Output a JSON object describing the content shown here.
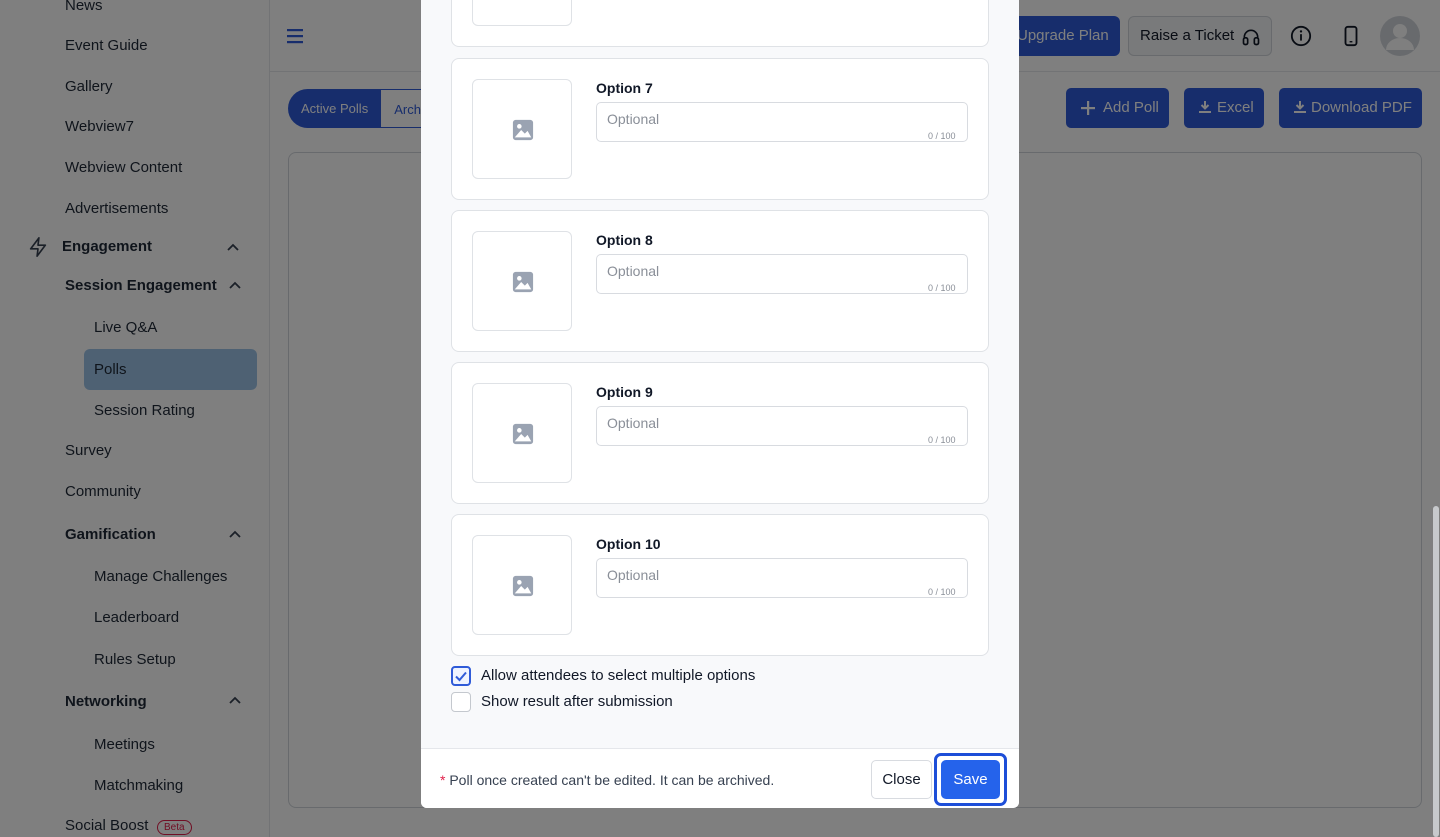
{
  "sidebar": {
    "items": [
      {
        "label": "News"
      },
      {
        "label": "Event Guide"
      },
      {
        "label": "Gallery"
      },
      {
        "label": "Webview7"
      },
      {
        "label": "Webview Content"
      },
      {
        "label": "Advertisements"
      }
    ],
    "engagement": {
      "label": "Engagement",
      "session_engagement": {
        "label": "Session Engagement",
        "items": [
          {
            "label": "Live Q&A"
          },
          {
            "label": "Polls",
            "active": true
          },
          {
            "label": "Session Rating"
          }
        ]
      },
      "survey": "Survey",
      "community": "Community",
      "gamification": {
        "label": "Gamification",
        "items": [
          {
            "label": "Manage Challenges"
          },
          {
            "label": "Leaderboard"
          },
          {
            "label": "Rules Setup"
          }
        ]
      },
      "networking": {
        "label": "Networking",
        "items": [
          {
            "label": "Meetings"
          },
          {
            "label": "Matchmaking"
          }
        ]
      },
      "social_boost": {
        "label": "Social Boost",
        "badge": "Beta"
      }
    }
  },
  "topbar": {
    "upgrade_label": "Upgrade Plan",
    "ticket_label": "Raise a Ticket"
  },
  "page": {
    "tabs": [
      {
        "label": "Active Polls"
      },
      {
        "label": "Archi"
      }
    ],
    "add_poll_label": "Add Poll",
    "excel_label": "Excel",
    "download_pdf_label": "Download PDF"
  },
  "modal": {
    "options": [
      {
        "label": "Option 7",
        "placeholder": "Optional",
        "value": "",
        "counter": "0 / 100"
      },
      {
        "label": "Option 8",
        "placeholder": "Optional",
        "value": "",
        "counter": "0 / 100"
      },
      {
        "label": "Option 9",
        "placeholder": "Optional",
        "value": "",
        "counter": "0 / 100"
      },
      {
        "label": "Option 10",
        "placeholder": "Optional",
        "value": "",
        "counter": "0 / 100"
      }
    ],
    "multi_select": {
      "label": "Allow attendees to select multiple options",
      "checked": true
    },
    "show_result": {
      "label": "Show result after submission",
      "checked": false
    },
    "footer_required": "*",
    "footer_note": "Poll once created can't be edited. It can be archived.",
    "close_label": "Close",
    "save_label": "Save"
  },
  "colors": {
    "primary": "#2f5bd8",
    "save": "#2563eb",
    "active_nav": "#9cc3e7",
    "required": "#e11d48"
  }
}
